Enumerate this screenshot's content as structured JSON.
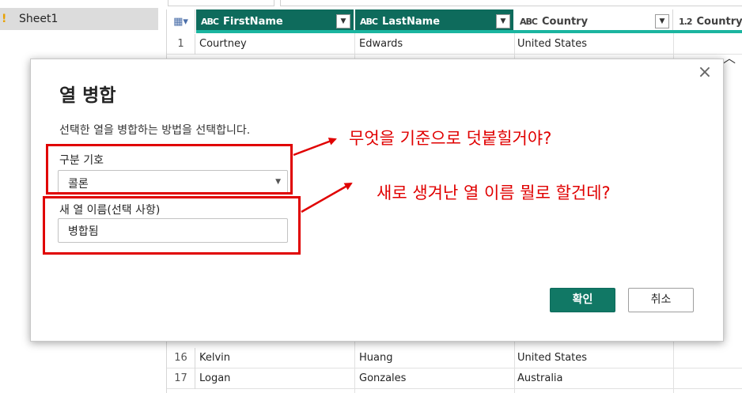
{
  "queries": {
    "items": [
      {
        "label": "Sheet1",
        "warning_icon": "warning-icon"
      }
    ]
  },
  "grid": {
    "columns": [
      {
        "type": "ABC",
        "name": "FirstName",
        "selected": true
      },
      {
        "type": "ABC",
        "name": "LastName",
        "selected": true
      },
      {
        "type": "ABC",
        "name": "Country",
        "selected": false
      },
      {
        "type": "1.2",
        "name": "Country",
        "selected": false
      }
    ],
    "rows_top": [
      {
        "num": "1",
        "first": "Courtney",
        "last": "Edwards",
        "country": "United States"
      }
    ],
    "rows_bottom": [
      {
        "num": "16",
        "first": "Kelvin",
        "last": "Huang",
        "country": "United States"
      },
      {
        "num": "17",
        "first": "Logan",
        "last": "Gonzales",
        "country": "Australia"
      }
    ]
  },
  "dialog": {
    "title": "열 병합",
    "description": "선택한 열을 병합하는 방법을 선택합니다.",
    "separator_label": "구분 기호",
    "separator_value": "콜론",
    "new_name_label": "새 열 이름(선택 사항)",
    "new_name_value": "병합됨",
    "ok_label": "확인",
    "cancel_label": "취소",
    "close_symbol": "×"
  },
  "annotations": {
    "note1": "무엇을 기준으로 덧붙힐거야?",
    "note2": "새로 생겨난 열 이름 뭘로 할건데?",
    "color": "#e00000"
  },
  "colors": {
    "accent": "#117865",
    "header_selected": "#0e6b5c",
    "header_bar": "#1bb5a0"
  }
}
